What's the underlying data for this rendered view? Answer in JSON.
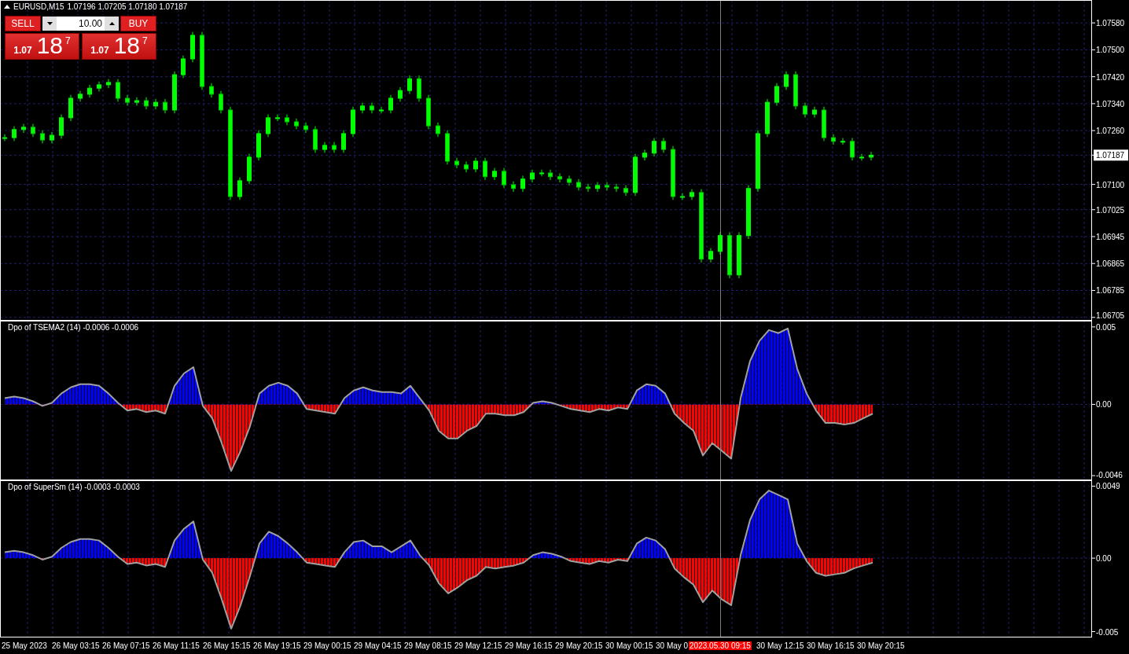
{
  "symbol_bar": {
    "title": "EURUSD,M15",
    "ohlc": "1.07196 1.07205 1.07180 1.07187"
  },
  "trade_panel": {
    "sell_label": "SELL",
    "buy_label": "BUY",
    "lot": "10.00",
    "sell_price": {
      "prefix": "1.07",
      "big": "18",
      "sup": "7"
    },
    "buy_price": {
      "prefix": "1.07",
      "big": "18",
      "sup": "7"
    }
  },
  "price_chart": {
    "chart_data": {
      "type": "candlestick",
      "grid": true,
      "ylim": [
        1.06695,
        1.07648
      ],
      "categories": [
        null,
        null,
        null,
        null,
        null,
        null,
        null,
        null,
        null,
        null,
        null,
        null,
        null,
        null,
        null,
        null,
        null,
        null,
        null,
        null,
        null,
        null,
        null,
        null,
        null,
        null,
        null,
        null,
        null,
        null,
        null,
        null,
        null,
        null,
        null,
        null,
        null,
        null,
        null,
        null,
        null,
        null,
        null,
        null,
        null,
        null,
        null,
        null,
        null,
        null,
        null,
        null,
        null,
        null,
        null,
        null,
        null,
        null,
        null,
        null,
        null,
        null,
        null,
        null,
        null,
        null,
        null,
        null,
        null,
        null,
        null,
        null,
        null,
        null,
        null,
        null,
        null,
        null,
        null,
        null,
        null,
        null,
        null,
        null,
        null,
        null,
        null,
        null,
        null,
        null,
        null,
        null,
        null,
        null,
        null,
        null,
        null,
        null,
        null,
        null,
        null,
        null,
        null,
        null,
        null,
        null,
        null,
        null,
        null,
        null,
        null,
        null,
        null,
        null,
        null,
        null
      ],
      "ohlc": [
        [
          1.07239,
          1.07249,
          1.07229,
          1.07239
        ],
        [
          1.07239,
          1.07273,
          1.07229,
          1.07263
        ],
        [
          1.07263,
          1.0728,
          1.07253,
          1.0727
        ],
        [
          1.0727,
          1.0728,
          1.07241,
          1.07251
        ],
        [
          1.07251,
          1.07261,
          1.07222,
          1.07232
        ],
        [
          1.07232,
          1.07256,
          1.07222,
          1.07246
        ],
        [
          1.07246,
          1.07308,
          1.07236,
          1.07298
        ],
        [
          1.07298,
          1.07366,
          1.07288,
          1.07356
        ],
        [
          1.07356,
          1.07378,
          1.07346,
          1.07368
        ],
        [
          1.07368,
          1.07396,
          1.07358,
          1.07386
        ],
        [
          1.07386,
          1.07406,
          1.07376,
          1.07396
        ],
        [
          1.07396,
          1.07413,
          1.07386,
          1.07403
        ],
        [
          1.07403,
          1.07413,
          1.07346,
          1.07356
        ],
        [
          1.07356,
          1.07366,
          1.07334,
          1.07344
        ],
        [
          1.07344,
          1.07359,
          1.07334,
          1.07349
        ],
        [
          1.07349,
          1.07359,
          1.07323,
          1.07333
        ],
        [
          1.07333,
          1.07354,
          1.07323,
          1.07344
        ],
        [
          1.07344,
          1.07354,
          1.07311,
          1.07321
        ],
        [
          1.07321,
          1.07436,
          1.07311,
          1.07426
        ],
        [
          1.07426,
          1.07483,
          1.07416,
          1.07473
        ],
        [
          1.07473,
          1.07553,
          1.07463,
          1.07543
        ],
        [
          1.07543,
          1.07553,
          1.07381,
          1.07391
        ],
        [
          1.07391,
          1.07401,
          1.07358,
          1.07368
        ],
        [
          1.07368,
          1.07378,
          1.07311,
          1.07321
        ],
        [
          1.07321,
          1.07331,
          1.07054,
          1.07064
        ],
        [
          1.07064,
          1.07121,
          1.07054,
          1.07111
        ],
        [
          1.07111,
          1.07191,
          1.07101,
          1.07181
        ],
        [
          1.07181,
          1.07261,
          1.07171,
          1.07251
        ],
        [
          1.07251,
          1.07308,
          1.07241,
          1.07298
        ],
        [
          1.07298,
          1.07308,
          1.07288,
          1.07298
        ],
        [
          1.07298,
          1.07308,
          1.07276,
          1.07286
        ],
        [
          1.07286,
          1.07296,
          1.07264,
          1.07274
        ],
        [
          1.07274,
          1.07284,
          1.07253,
          1.07263
        ],
        [
          1.07263,
          1.07273,
          1.07194,
          1.07204
        ],
        [
          1.07204,
          1.07226,
          1.07194,
          1.07216
        ],
        [
          1.07216,
          1.07226,
          1.07194,
          1.07204
        ],
        [
          1.07204,
          1.07261,
          1.07194,
          1.07251
        ],
        [
          1.07251,
          1.07331,
          1.07241,
          1.07321
        ],
        [
          1.07321,
          1.07343,
          1.07311,
          1.07333
        ],
        [
          1.07333,
          1.07343,
          1.07311,
          1.07321
        ],
        [
          1.07321,
          1.07331,
          1.07311,
          1.07321
        ],
        [
          1.07321,
          1.07366,
          1.07311,
          1.07356
        ],
        [
          1.07356,
          1.07389,
          1.07346,
          1.07379
        ],
        [
          1.07379,
          1.07424,
          1.07369,
          1.07414
        ],
        [
          1.07414,
          1.07424,
          1.07346,
          1.07356
        ],
        [
          1.07356,
          1.07366,
          1.07264,
          1.07274
        ],
        [
          1.07274,
          1.07284,
          1.07241,
          1.07251
        ],
        [
          1.07251,
          1.07261,
          1.07159,
          1.07169
        ],
        [
          1.07169,
          1.07179,
          1.07148,
          1.07158
        ],
        [
          1.07158,
          1.07168,
          1.07136,
          1.07146
        ],
        [
          1.07146,
          1.07179,
          1.07136,
          1.07169
        ],
        [
          1.07169,
          1.07179,
          1.07113,
          1.07123
        ],
        [
          1.07123,
          1.07149,
          1.07113,
          1.07139
        ],
        [
          1.07139,
          1.07149,
          1.07089,
          1.07099
        ],
        [
          1.07099,
          1.07109,
          1.07078,
          1.07088
        ],
        [
          1.07088,
          1.07126,
          1.07078,
          1.07116
        ],
        [
          1.07116,
          1.07144,
          1.07106,
          1.07134
        ],
        [
          1.07134,
          1.07144,
          1.07124,
          1.07134
        ],
        [
          1.07134,
          1.07144,
          1.07113,
          1.07123
        ],
        [
          1.07123,
          1.07133,
          1.07106,
          1.07116
        ],
        [
          1.07116,
          1.07126,
          1.07096,
          1.07106
        ],
        [
          1.07106,
          1.07116,
          1.07082,
          1.07092
        ],
        [
          1.07092,
          1.07102,
          1.07078,
          1.07088
        ],
        [
          1.07088,
          1.07107,
          1.07078,
          1.07097
        ],
        [
          1.07097,
          1.07107,
          1.07082,
          1.07092
        ],
        [
          1.07092,
          1.07102,
          1.07078,
          1.07088
        ],
        [
          1.07088,
          1.07098,
          1.07066,
          1.07076
        ],
        [
          1.07076,
          1.07191,
          1.07066,
          1.07181
        ],
        [
          1.07181,
          1.07203,
          1.07171,
          1.07193
        ],
        [
          1.07193,
          1.07238,
          1.07183,
          1.07228
        ],
        [
          1.07228,
          1.07238,
          1.07194,
          1.07204
        ],
        [
          1.07204,
          1.07214,
          1.07054,
          1.07064
        ],
        [
          1.07064,
          1.07074,
          1.07054,
          1.07064
        ],
        [
          1.07064,
          1.07086,
          1.07054,
          1.07076
        ],
        [
          1.07076,
          1.07086,
          1.06868,
          1.06878
        ],
        [
          1.06878,
          1.06911,
          1.06868,
          1.06901
        ],
        [
          1.06901,
          1.06958,
          1.06891,
          1.06948
        ],
        [
          1.06948,
          1.06958,
          1.06821,
          1.06831
        ],
        [
          1.06831,
          1.06958,
          1.06821,
          1.06948
        ],
        [
          1.06948,
          1.07098,
          1.06938,
          1.07088
        ],
        [
          1.07088,
          1.07261,
          1.07078,
          1.07251
        ],
        [
          1.07251,
          1.07354,
          1.07241,
          1.07344
        ],
        [
          1.07344,
          1.07401,
          1.07334,
          1.07391
        ],
        [
          1.07391,
          1.07436,
          1.07381,
          1.07426
        ],
        [
          1.07426,
          1.07436,
          1.07323,
          1.07333
        ],
        [
          1.07333,
          1.07343,
          1.07299,
          1.07309
        ],
        [
          1.07309,
          1.07331,
          1.07299,
          1.07321
        ],
        [
          1.07321,
          1.07331,
          1.07229,
          1.07239
        ],
        [
          1.07239,
          1.07249,
          1.07218,
          1.07228
        ],
        [
          1.07228,
          1.07238,
          1.07218,
          1.07228
        ],
        [
          1.07228,
          1.07238,
          1.07171,
          1.07181
        ],
        [
          1.07181,
          1.07191,
          1.07171,
          1.07181
        ],
        [
          1.07181,
          1.07197,
          1.07171,
          1.07187
        ],
        null,
        null,
        null,
        null,
        null,
        null,
        null,
        null,
        null,
        null,
        null,
        null,
        null,
        null,
        null,
        null,
        null,
        null,
        null,
        null,
        null,
        null,
        null
      ],
      "yticks": [
        {
          "value": 1.0758,
          "label": "1.07580"
        },
        {
          "value": 1.075,
          "label": "1.07500"
        },
        {
          "value": 1.0742,
          "label": "1.07420"
        },
        {
          "value": 1.0734,
          "label": "1.07340"
        },
        {
          "value": 1.0726,
          "label": "1.07260"
        },
        {
          "value": 1.07187,
          "label": "1.07187"
        },
        {
          "value": 1.071,
          "label": "1.07100"
        },
        {
          "value": 1.07025,
          "label": "1.07025"
        },
        {
          "value": 1.06945,
          "label": "1.06945"
        },
        {
          "value": 1.06865,
          "label": "1.06865"
        },
        {
          "value": 1.06785,
          "label": "1.06785"
        },
        {
          "value": 1.06705,
          "label": "1.06705"
        }
      ]
    }
  },
  "indicators": [
    {
      "title": "Dpo of TSEMA2 (14) -0.0006 -0.0006",
      "chart_data": {
        "type": "area",
        "grid": true,
        "ylim": [
          -0.0049,
          0.0054
        ],
        "values": [
          0.0004,
          0.0005,
          0.0004,
          0.0002,
          -0.0001,
          0.0001,
          0.0007,
          0.0011,
          0.0013,
          0.0013,
          0.0012,
          0.0007,
          0.0001,
          -0.0004,
          -0.0003,
          -0.0005,
          -0.0004,
          -0.0006,
          0.0012,
          0.002,
          0.0024,
          -0.0001,
          -0.0009,
          -0.0025,
          -0.0043,
          -0.003,
          -0.0014,
          0.0007,
          0.0012,
          0.0014,
          0.0012,
          0.0007,
          -0.0003,
          -0.0004,
          -0.0005,
          -0.0006,
          0.0004,
          0.0009,
          0.0011,
          0.0009,
          0.0008,
          0.0008,
          0.0007,
          0.0012,
          0.0004,
          -0.0004,
          -0.0017,
          -0.0022,
          -0.0022,
          -0.0017,
          -0.0014,
          -0.0006,
          -0.0006,
          -0.0007,
          -0.0007,
          -0.0005,
          0.0001,
          0.0002,
          0.0001,
          -0.0001,
          -0.0003,
          -0.0004,
          -0.0005,
          -0.0003,
          -0.0004,
          -0.0002,
          -0.0003,
          0.0009,
          0.0013,
          0.0012,
          0.0007,
          -0.0006,
          -0.0012,
          -0.0017,
          -0.0033,
          -0.0025,
          -0.003,
          -0.0035,
          0.0004,
          0.0028,
          0.0041,
          0.0048,
          0.0046,
          0.0049,
          0.0023,
          0.0007,
          -0.0004,
          -0.0012,
          -0.0012,
          -0.0013,
          -0.0012,
          -0.0009,
          -0.0006
        ],
        "yticks": [
          {
            "value": 0.005,
            "label": "0.005"
          },
          {
            "value": 0,
            "label": "0.00"
          },
          {
            "value": -0.0046,
            "label": "-0.0046"
          }
        ]
      }
    },
    {
      "title": "Dpo of SuperSm (14) -0.0003 -0.0003",
      "chart_data": {
        "type": "area",
        "grid": true,
        "ylim": [
          -0.0054,
          0.0053
        ],
        "values": [
          0.0004,
          0.0005,
          0.0004,
          0.0002,
          -0.0001,
          0.0001,
          0.0007,
          0.0011,
          0.0013,
          0.0013,
          0.0012,
          0.0007,
          0.0001,
          -0.0004,
          -0.0003,
          -0.0005,
          -0.0004,
          -0.0006,
          0.0012,
          0.002,
          0.0025,
          -0.0001,
          -0.001,
          -0.0028,
          -0.0048,
          -0.0032,
          -0.0012,
          0.001,
          0.0018,
          0.0015,
          0.001,
          0.0004,
          -0.0003,
          -0.0004,
          -0.0005,
          -0.0006,
          0.0004,
          0.0011,
          0.0012,
          0.0008,
          0.0008,
          0.0004,
          0.0008,
          0.0012,
          0.0002,
          -0.0005,
          -0.0017,
          -0.0024,
          -0.002,
          -0.0015,
          -0.0012,
          -0.0006,
          -0.0007,
          -0.0006,
          -0.0005,
          -0.0003,
          0.0002,
          0.0004,
          0.0003,
          0.0001,
          -0.0002,
          -0.0003,
          -0.0004,
          -0.0002,
          -0.0003,
          -0.0001,
          -0.0002,
          0.001,
          0.0014,
          0.0012,
          0.0006,
          -0.0007,
          -0.0013,
          -0.0018,
          -0.003,
          -0.0022,
          -0.0028,
          -0.0032,
          0.0002,
          0.0026,
          0.004,
          0.0046,
          0.0043,
          0.004,
          0.001,
          -0.0002,
          -0.001,
          -0.0012,
          -0.0011,
          -0.001,
          -0.0007,
          -0.0005,
          -0.0003
        ],
        "yticks": [
          {
            "value": 0.0049,
            "label": "0.0049"
          },
          {
            "value": 0,
            "label": "0.00"
          },
          {
            "value": -0.005,
            "label": "-0.005"
          }
        ]
      }
    }
  ],
  "time_axis": {
    "labels_before": [
      "25 May 2023",
      "26 May 03:15",
      "26 May 07:15",
      "26 May 11:15",
      "26 May 15:15",
      "26 May 19:15",
      "29 May 00:15",
      "29 May 04:15",
      "29 May 08:15",
      "29 May 12:15",
      "29 May 16:15",
      "29 May 20:15",
      "30 May 00:15"
    ],
    "partial_label": "30 May 0",
    "crosshair_label": "2023.05.30 09:15",
    "labels_after": [
      "30 May 12:15",
      "30 May 16:15",
      "30 May 20:15"
    ]
  }
}
